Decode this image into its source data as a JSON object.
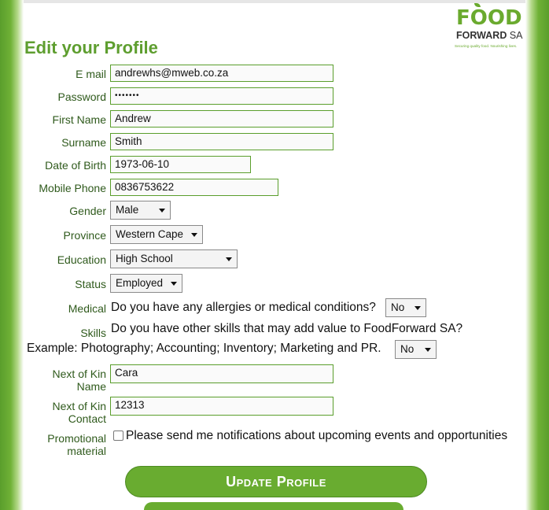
{
  "logo": {
    "food": "FOOD",
    "forward": "FORWARD",
    "sa": "SA",
    "tagline": "Securing quality food. Nourishing lives."
  },
  "page_title": "Edit your Profile",
  "fields": {
    "email": {
      "label": "E mail",
      "value": "andrewhs@mweb.co.za"
    },
    "password": {
      "label": "Password",
      "value": "•••••••"
    },
    "first_name": {
      "label": "First Name",
      "value": "Andrew"
    },
    "surname": {
      "label": "Surname",
      "value": "Smith"
    },
    "dob": {
      "label": "Date of Birth",
      "value": "1973-06-10"
    },
    "mobile": {
      "label": "Mobile Phone",
      "value": "0836753622"
    },
    "gender": {
      "label": "Gender",
      "value": "Male"
    },
    "province": {
      "label": "Province",
      "value": "Western Cape"
    },
    "education": {
      "label": "Education",
      "value": "High School"
    },
    "status": {
      "label": "Status",
      "value": "Employed"
    },
    "medical": {
      "label": "Medical",
      "question": "Do you have any allergies or medical conditions?",
      "value": "No"
    },
    "skills": {
      "label": "Skills",
      "question": "Do you have other skills that may add value to FoodForward SA?",
      "example": "Example: Photography; Accounting; Inventory; Marketing and PR.",
      "value": "No"
    },
    "next_of_kin_name": {
      "label_line1": "Next of Kin",
      "label_line2": "Name",
      "value": "Cara"
    },
    "next_of_kin_contact": {
      "label_line1": "Next of Kin",
      "label_line2": "Contact",
      "value": "12313"
    },
    "promotional": {
      "label_line1": "Promotional",
      "label_line2": "material",
      "text": "Please send me notifications about upcoming events and opportunities",
      "checked": false
    }
  },
  "update_button": "Update Profile",
  "colors": {
    "brand_green": "#69ac30",
    "label_green": "#2f5a1c",
    "title_green": "#5e9e2f"
  }
}
